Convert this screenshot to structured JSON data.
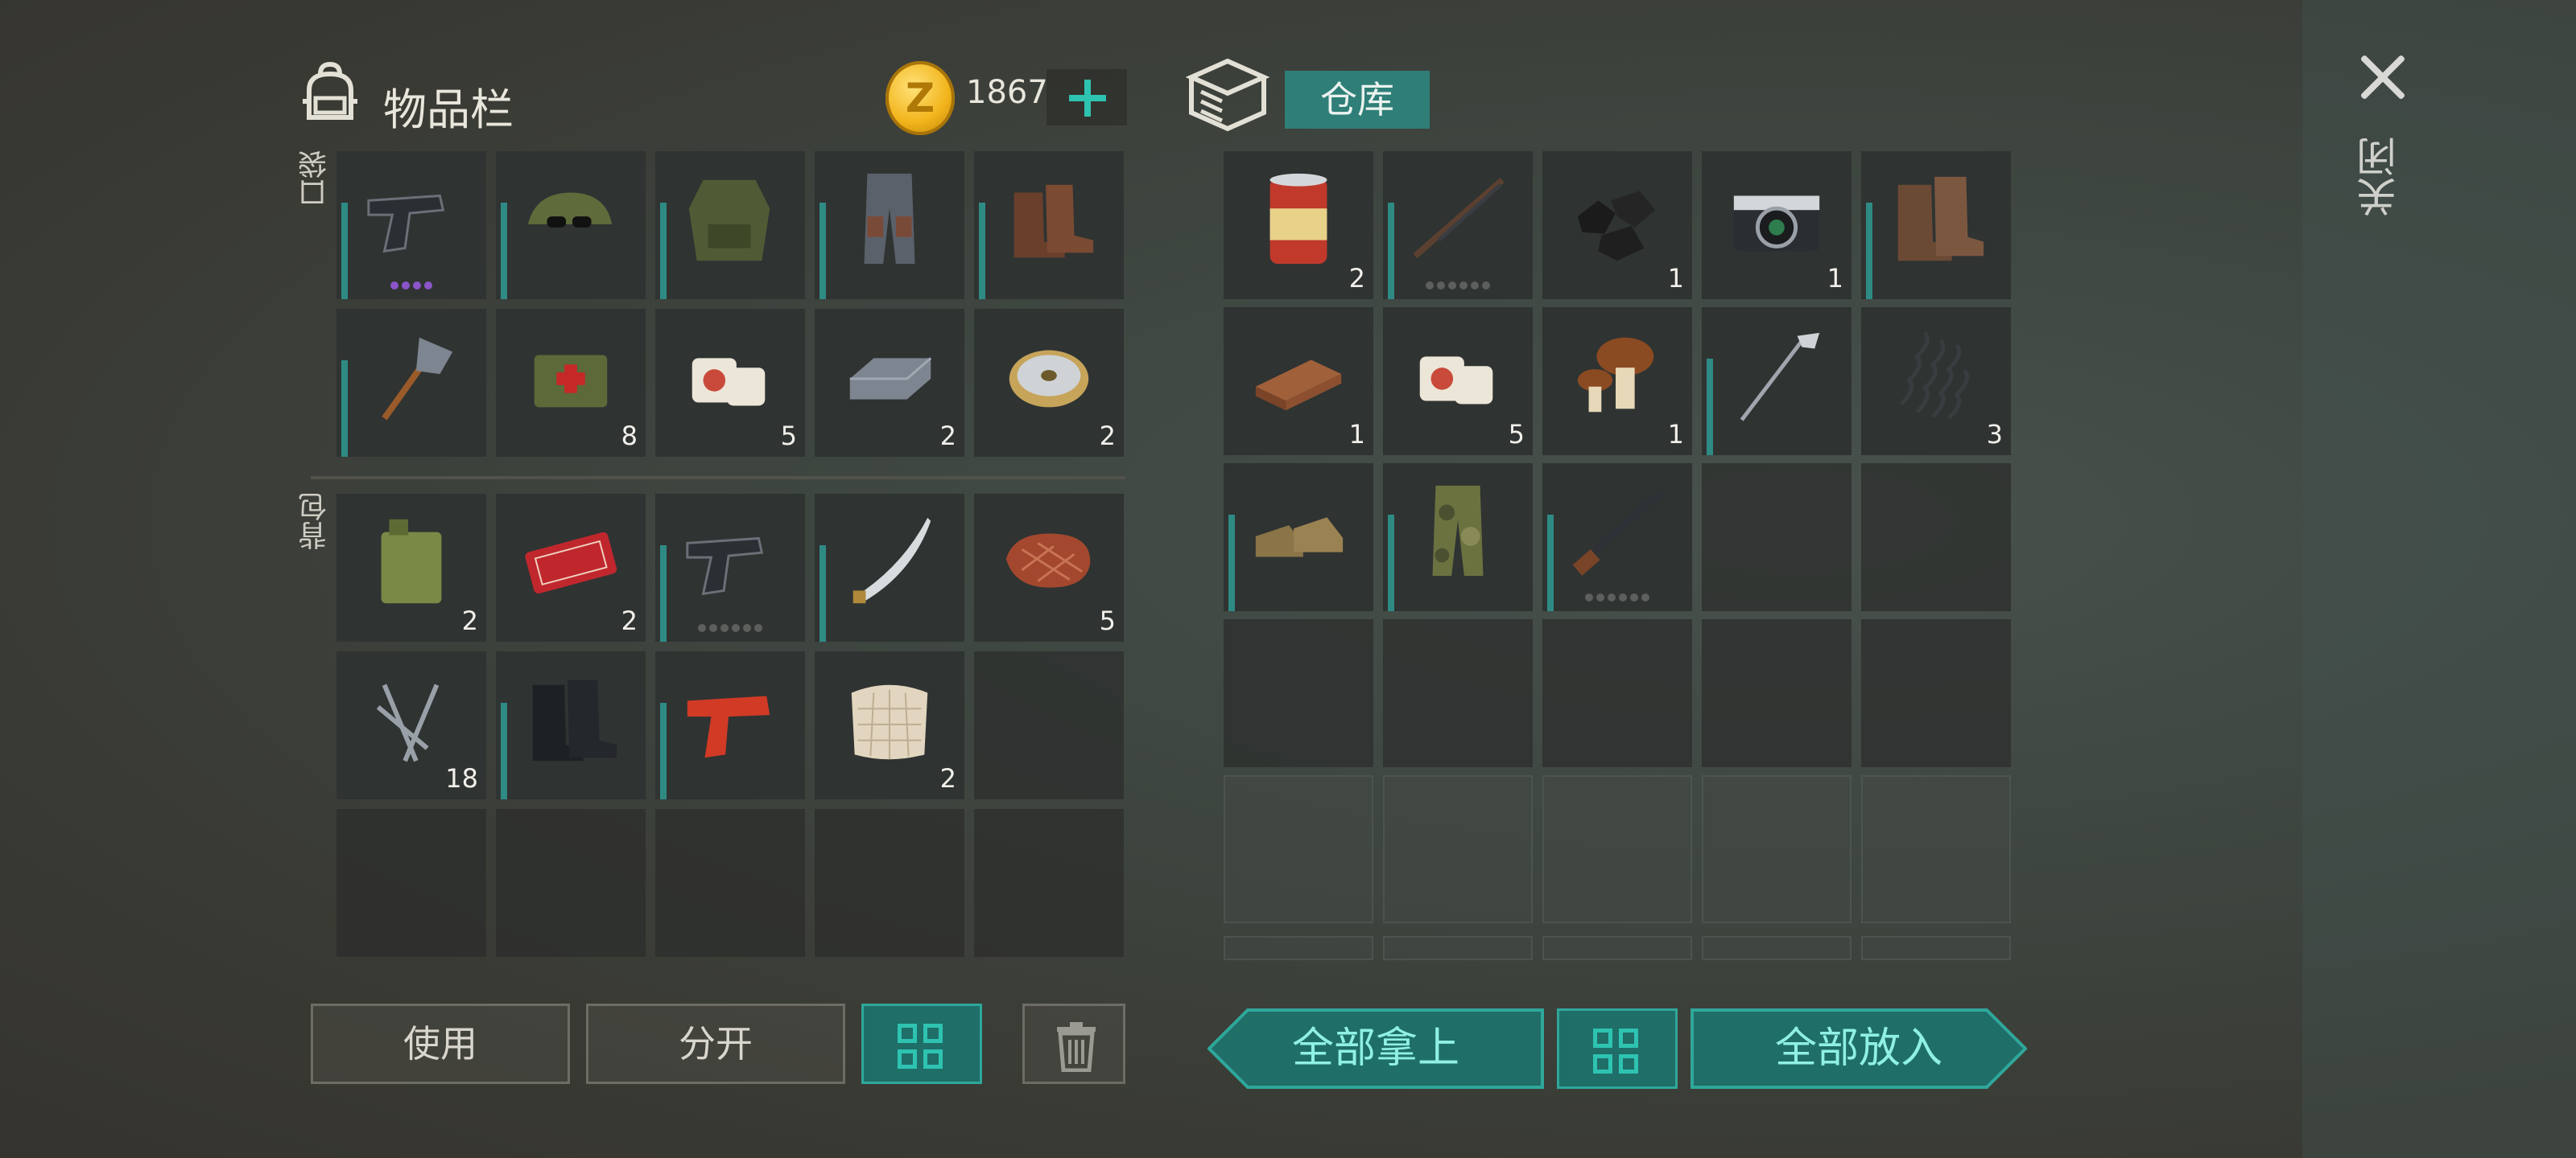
{
  "inventory": {
    "title": "物品栏",
    "currency": "1867",
    "pocket_label": "口袋",
    "backpack_label": "背包",
    "pocket": [
      {
        "name": "pistol-icon",
        "qty": "",
        "dots": "purple"
      },
      {
        "name": "cap-with-sunglasses-icon",
        "qty": ""
      },
      {
        "name": "combat-vest-icon",
        "qty": ""
      },
      {
        "name": "armored-pants-icon",
        "qty": ""
      },
      {
        "name": "leather-boots-icon",
        "qty": ""
      },
      {
        "name": "shovel-icon",
        "qty": ""
      },
      {
        "name": "medical-bag-icon",
        "qty": "8"
      },
      {
        "name": "bandage-icon",
        "qty": "5"
      },
      {
        "name": "iron-ingot-icon",
        "qty": "2"
      },
      {
        "name": "wire-spool-icon",
        "qty": "2"
      }
    ],
    "backpack": [
      {
        "name": "jerrycan-icon",
        "qty": "2"
      },
      {
        "name": "coupon-ticket-icon",
        "qty": "2"
      },
      {
        "name": "pistol-icon",
        "qty": "",
        "dots": "gray"
      },
      {
        "name": "katana-icon",
        "qty": ""
      },
      {
        "name": "steak-icon",
        "qty": "5"
      },
      {
        "name": "nails-icon",
        "qty": "18"
      },
      {
        "name": "combat-boots-icon",
        "qty": ""
      },
      {
        "name": "flare-gun-icon",
        "qty": ""
      },
      {
        "name": "cloth-icon",
        "qty": "2"
      },
      {
        "name": "empty",
        "qty": ""
      },
      {
        "name": "empty",
        "qty": ""
      },
      {
        "name": "empty",
        "qty": ""
      },
      {
        "name": "empty",
        "qty": ""
      },
      {
        "name": "empty",
        "qty": ""
      },
      {
        "name": "empty",
        "qty": ""
      }
    ],
    "buttons": {
      "use": "使用",
      "split": "分开"
    }
  },
  "storage": {
    "title": "仓库",
    "items": [
      {
        "name": "food-can-icon",
        "qty": "2"
      },
      {
        "name": "rifle-icon",
        "qty": "",
        "dots": "gray"
      },
      {
        "name": "coal-icon",
        "qty": "1"
      },
      {
        "name": "camera-icon",
        "qty": "1"
      },
      {
        "name": "boots-icon",
        "qty": ""
      },
      {
        "name": "wood-plank-icon",
        "qty": "1"
      },
      {
        "name": "bandage-icon",
        "qty": "5"
      },
      {
        "name": "mushroom-icon",
        "qty": "1"
      },
      {
        "name": "golf-club-icon",
        "qty": ""
      },
      {
        "name": "spring-icon",
        "qty": "3"
      },
      {
        "name": "shoes-icon",
        "qty": ""
      },
      {
        "name": "camo-pants-icon",
        "qty": ""
      },
      {
        "name": "shotgun-icon",
        "qty": "",
        "dots": "gray"
      }
    ],
    "take_all": "全部拿上",
    "put_all": "全部放入"
  },
  "close_label": "关闭",
  "accent_color": "#2ec3b1"
}
